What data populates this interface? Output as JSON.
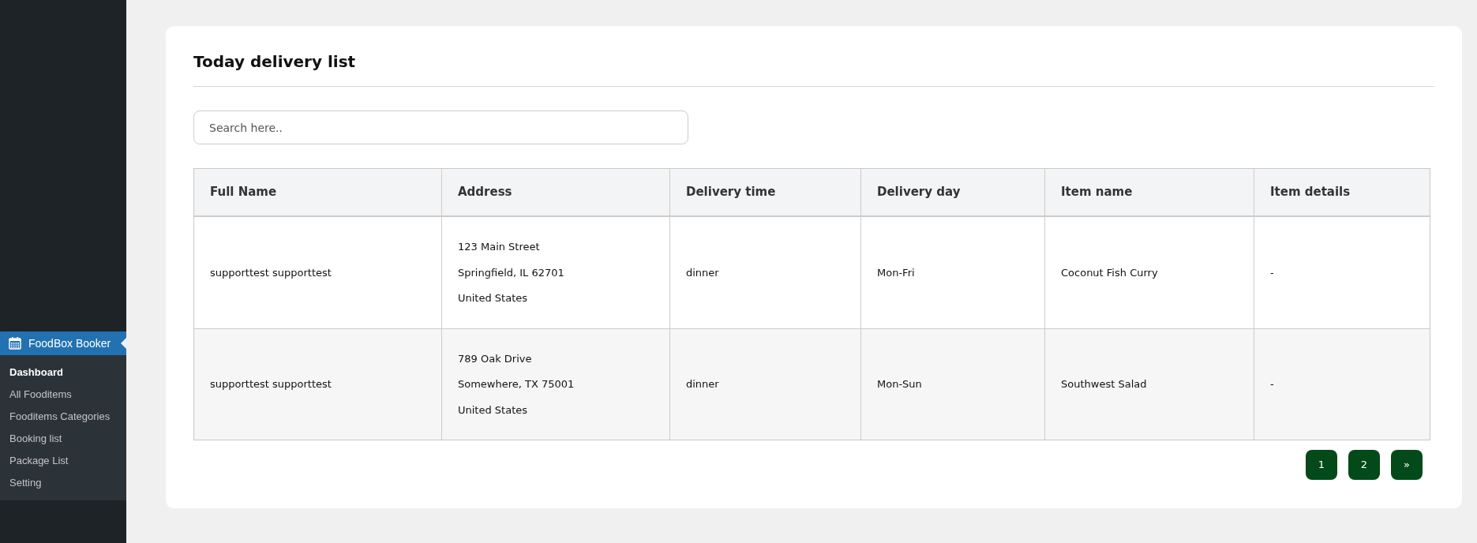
{
  "sidebar": {
    "plugin": {
      "label": "FoodBox Booker"
    },
    "items": [
      {
        "label": "Dashboard",
        "selected": true
      },
      {
        "label": "All Fooditems",
        "selected": false
      },
      {
        "label": "Fooditems Categories",
        "selected": false
      },
      {
        "label": "Booking list",
        "selected": false
      },
      {
        "label": "Package List",
        "selected": false
      },
      {
        "label": "Setting",
        "selected": false
      }
    ]
  },
  "card": {
    "title": "Today delivery list",
    "search": {
      "placeholder": "Search here.."
    },
    "table": {
      "columns": [
        "Full Name",
        "Address",
        "Delivery time",
        "Delivery day",
        "Item name",
        "Item details"
      ],
      "rows": [
        {
          "cells": [
            "supporttest supporttest",
            [
              "123 Main Street",
              "Springfield, IL 62701",
              "United States"
            ],
            "dinner",
            "Mon-Fri",
            "Coconut Fish Curry",
            "-"
          ]
        },
        {
          "cells": [
            "supporttest supporttest",
            [
              "789 Oak Drive",
              "Somewhere, TX 75001",
              "United States"
            ],
            "dinner",
            "Mon-Sun",
            "Southwest Salad",
            "-"
          ]
        }
      ]
    },
    "pagination": [
      "1",
      "2",
      "»"
    ]
  }
}
